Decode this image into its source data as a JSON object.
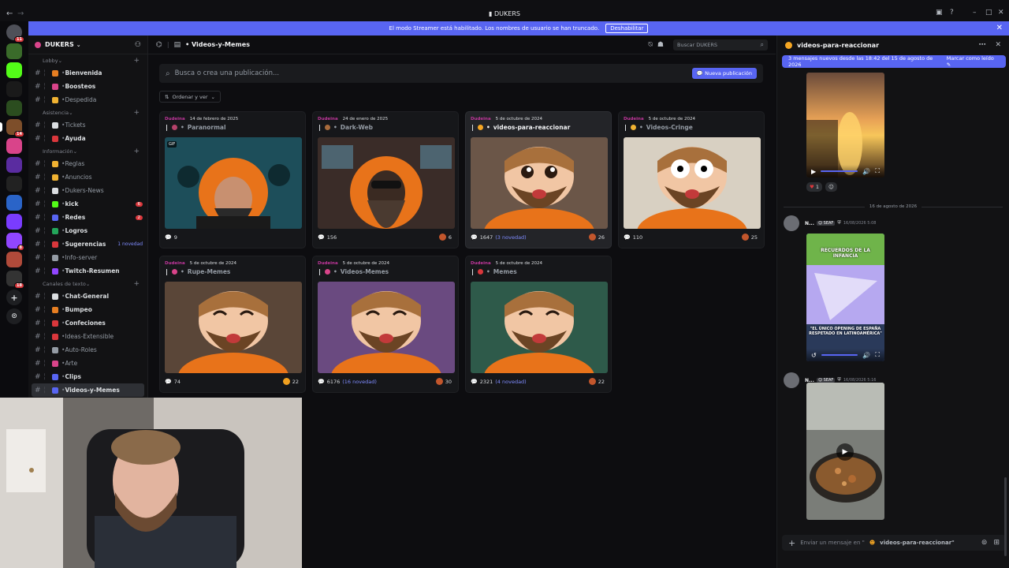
{
  "window": {
    "title": "DUKERS",
    "back": "←",
    "forward": "→"
  },
  "streamer_bar": {
    "text": "El modo Streamer está habilitado. Los nombres de usuario se han truncado.",
    "button": "Deshabilitar"
  },
  "server_rail": {
    "servers": [
      {
        "name": "Direct messages",
        "color": "#4e5058",
        "badge": "11"
      },
      {
        "name": "server-2",
        "color": "#3a6b2a",
        "badge": ""
      },
      {
        "name": "Kick",
        "color": "#53fc18",
        "badge": ""
      },
      {
        "name": "NOIZ",
        "color": "#1a1a1a",
        "badge": ""
      },
      {
        "name": "server-5",
        "color": "#2b4d1f",
        "badge": ""
      },
      {
        "name": "DUKERS",
        "color": "#7d4e2a",
        "badge": "14",
        "active": true
      },
      {
        "name": "server-7",
        "color": "#d9448a",
        "badge": ""
      },
      {
        "name": "server-8",
        "color": "#5a2ca0",
        "badge": ""
      },
      {
        "name": "server-9",
        "color": "#222222",
        "badge": ""
      },
      {
        "name": "server-10",
        "color": "#2a64c8",
        "badge": ""
      },
      {
        "name": "server-11",
        "color": "#7a3cff",
        "badge": ""
      },
      {
        "name": "server-12",
        "color": "#9146ff",
        "badge": "8"
      },
      {
        "name": "server-13",
        "color": "#b04a3a",
        "badge": ""
      },
      {
        "name": "server-14",
        "color": "#333333",
        "badge": "18"
      }
    ],
    "add_label": "+",
    "discover_label": "⊙"
  },
  "sidebar": {
    "guild_name": "DUKERS",
    "categories": [
      {
        "name": "Lobby",
        "channels": [
          {
            "label": "Bienvenida",
            "color": "#e67e22",
            "bold": true
          },
          {
            "label": "Boosteos",
            "color": "#d9448a",
            "bold": true
          },
          {
            "label": "Despedida",
            "color": "#f0b232",
            "bold": false
          }
        ]
      },
      {
        "name": "Asistencia",
        "channels": [
          {
            "label": "Tickets",
            "color": "#dbdee1",
            "bold": false
          },
          {
            "label": "Ayuda",
            "color": "#da373c",
            "bold": true
          }
        ]
      },
      {
        "name": "Información",
        "channels": [
          {
            "label": "Reglas",
            "color": "#f0b232",
            "bold": false
          },
          {
            "label": "Anuncios",
            "color": "#f0b232",
            "bold": false
          },
          {
            "label": "Dukers-News",
            "color": "#dbdee1",
            "bold": false
          },
          {
            "label": "kick",
            "color": "#53fc18",
            "bold": true,
            "badge": "6"
          },
          {
            "label": "Redes",
            "color": "#5865f2",
            "bold": true,
            "badge": "2"
          },
          {
            "label": "Logros",
            "color": "#23a55a",
            "bold": true
          },
          {
            "label": "Sugerencias",
            "color": "#da373c",
            "bold": true,
            "novedad": "1 novedad"
          },
          {
            "label": "Info-server",
            "color": "#949ba4",
            "bold": false
          },
          {
            "label": "Twitch-Resumen",
            "color": "#9146ff",
            "bold": true
          }
        ]
      },
      {
        "name": "Canales de texto",
        "channels": [
          {
            "label": "Chat-General",
            "color": "#dbdee1",
            "bold": true
          },
          {
            "label": "Bumpeo",
            "color": "#e67e22",
            "bold": true
          },
          {
            "label": "Confeciones",
            "color": "#da373c",
            "bold": true
          },
          {
            "label": "Ideas-Extensible",
            "color": "#da373c",
            "bold": false
          },
          {
            "label": "Auto-Roles",
            "color": "#949ba4",
            "bold": false
          },
          {
            "label": "Arte",
            "color": "#d9448a",
            "bold": false
          },
          {
            "label": "Clips",
            "color": "#5865f2",
            "bold": true
          },
          {
            "label": "Videos-y-Memes",
            "color": "#5865f2",
            "bold": true,
            "active": true
          }
        ]
      }
    ]
  },
  "main": {
    "channel_name": "Videos-y-Memes",
    "search_placeholder": "Buscar DUKERS",
    "post_placeholder": "Busca o crea una publicación...",
    "new_post": "Nueva publicación",
    "sort_label": "Ordenar y ver",
    "cards": [
      {
        "author": "Dudeina",
        "date": "14 de febrero de 2025",
        "title": "Paranormal",
        "emo": "#b5426a",
        "count": "9",
        "novedad": "",
        "react": "",
        "react_color": "",
        "gif": true,
        "scene": "teal"
      },
      {
        "author": "Dudeina",
        "date": "24 de enero de 2025",
        "title": "Dark-Web",
        "emo": "#a86b3c",
        "count": "156",
        "novedad": "",
        "react": "6",
        "react_color": "#c2562c",
        "gif": false,
        "scene": "dark"
      },
      {
        "author": "Dudeina",
        "date": "5 de octubre de 2024",
        "title": "videos-para-reaccionar",
        "emo": "#f5a623",
        "count": "1647",
        "novedad": "(3 novedad)",
        "react": "26",
        "react_color": "#c2562c",
        "gif": false,
        "scene": "chibi",
        "highlight": true
      },
      {
        "author": "Dudeina",
        "date": "5 de octubre de 2024",
        "title": "Videos-Cringe",
        "emo": "#f0b232",
        "count": "110",
        "novedad": "",
        "react": "25",
        "react_color": "#c2562c",
        "gif": false,
        "scene": "shock"
      },
      {
        "author": "Dudeina",
        "date": "5 de octubre de 2024",
        "title": "Rupe-Memes",
        "emo": "#d9448a",
        "count": "74",
        "novedad": "",
        "react": "22",
        "react_color": "#f0a020",
        "gif": false,
        "scene": "laugh"
      },
      {
        "author": "Dudeina",
        "date": "5 de octubre de 2024",
        "title": "Videos-Memes",
        "emo": "#d9448a",
        "count": "6176",
        "novedad": "(16 novedad)",
        "react": "30",
        "react_color": "#c2562c",
        "gif": false,
        "scene": "lol"
      },
      {
        "author": "Dudeina",
        "date": "5 de octubre de 2024",
        "title": "Memes",
        "emo": "#da373c",
        "count": "2321",
        "novedad": "(4 novedad)",
        "react": "22",
        "react_color": "#c2562c",
        "gif": false,
        "scene": "happy"
      }
    ]
  },
  "right_panel": {
    "title": "videos-para-reaccionar",
    "new_messages": "3 mensajes nuevos desde las 18:42 del 15 de agosto de 2026",
    "mark_read": "Marcar como leído",
    "reaction_count": "1",
    "date_divider": "16 de agosto de 2026",
    "messages": [
      {
        "name": "N...",
        "tag": "SEAF",
        "time": "16/08/2026 5:08",
        "caption_top": "RECUERDOS DE LA INFANCIA",
        "caption_bottom": "\"EL ÚNICO OPENING DE ESPAÑA RESPETADO EN LATINOAMÉRICA\""
      },
      {
        "name": "N...",
        "tag": "SEAF",
        "time": "16/08/2026 5:16"
      }
    ],
    "composer_placeholder": "Enviar un mensaje en \"",
    "composer_channel": "videos-para-reaccionar\""
  },
  "colors": {
    "accent": "#5865f2",
    "danger": "#da373c",
    "background": "#0d0d10",
    "sidebar": "#121214"
  }
}
